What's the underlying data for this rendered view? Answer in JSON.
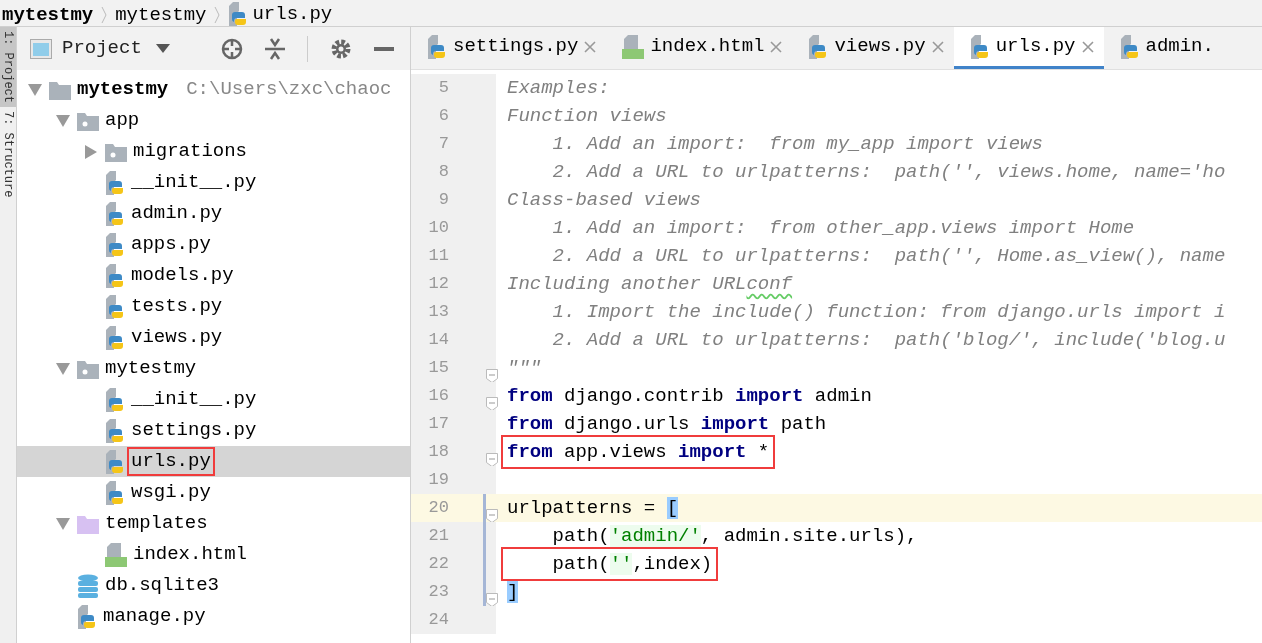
{
  "breadcrumb": [
    {
      "text": "mytestmy",
      "bold": true,
      "kind": "text"
    },
    {
      "text": "mytestmy",
      "bold": false,
      "kind": "text"
    },
    {
      "text": "urls.py",
      "bold": false,
      "kind": "py"
    }
  ],
  "tool_strip": [
    {
      "label": "1: Project",
      "selected": true
    },
    {
      "label": "7: Structure",
      "selected": false
    }
  ],
  "project_panel": {
    "title": "Project",
    "tree": [
      {
        "name": "mytestmy",
        "kind": "folder",
        "path": "C:\\Users\\zxc\\chaoc",
        "expanded": true,
        "selected": false,
        "annotated": false,
        "children": [
          {
            "name": "app",
            "kind": "package",
            "expanded": true,
            "selected": false,
            "annotated": false,
            "children": [
              {
                "name": "migrations",
                "kind": "package",
                "expanded": false,
                "selected": false,
                "annotated": false
              },
              {
                "name": "__init__.py",
                "kind": "py",
                "selected": false,
                "annotated": false
              },
              {
                "name": "admin.py",
                "kind": "py",
                "selected": false,
                "annotated": false
              },
              {
                "name": "apps.py",
                "kind": "py",
                "selected": false,
                "annotated": false
              },
              {
                "name": "models.py",
                "kind": "py",
                "selected": false,
                "annotated": false
              },
              {
                "name": "tests.py",
                "kind": "py",
                "selected": false,
                "annotated": false
              },
              {
                "name": "views.py",
                "kind": "py",
                "selected": false,
                "annotated": false
              }
            ]
          },
          {
            "name": "mytestmy",
            "kind": "package",
            "expanded": true,
            "selected": false,
            "annotated": false,
            "children": [
              {
                "name": "__init__.py",
                "kind": "py",
                "selected": false,
                "annotated": false
              },
              {
                "name": "settings.py",
                "kind": "py",
                "selected": false,
                "annotated": false
              },
              {
                "name": "urls.py",
                "kind": "py",
                "selected": true,
                "annotated": true
              },
              {
                "name": "wsgi.py",
                "kind": "py",
                "selected": false,
                "annotated": false
              }
            ]
          },
          {
            "name": "templates",
            "kind": "templates",
            "expanded": true,
            "selected": false,
            "annotated": false,
            "children": [
              {
                "name": "index.html",
                "kind": "html",
                "selected": false,
                "annotated": false
              }
            ]
          },
          {
            "name": "db.sqlite3",
            "kind": "db",
            "selected": false,
            "annotated": false
          },
          {
            "name": "manage.py",
            "kind": "py",
            "selected": false,
            "annotated": false
          }
        ]
      }
    ]
  },
  "tabs": [
    {
      "label": "settings.py",
      "kind": "py",
      "selected": false,
      "closable": true
    },
    {
      "label": "index.html",
      "kind": "html",
      "selected": false,
      "closable": true
    },
    {
      "label": "views.py",
      "kind": "py",
      "selected": false,
      "closable": true
    },
    {
      "label": "urls.py",
      "kind": "py",
      "selected": true,
      "closable": true
    },
    {
      "label": "admin.",
      "kind": "py",
      "selected": false,
      "closable": false
    }
  ],
  "editor": {
    "lines": [
      {
        "number": "5",
        "current": false,
        "modified": false,
        "fold": false,
        "annotated": false,
        "tokens": [
          {
            "kind": "comment",
            "text": "Examples:"
          }
        ]
      },
      {
        "number": "6",
        "current": false,
        "modified": false,
        "fold": false,
        "annotated": false,
        "tokens": [
          {
            "kind": "comment",
            "text": "Function views"
          }
        ]
      },
      {
        "number": "7",
        "current": false,
        "modified": false,
        "fold": false,
        "annotated": false,
        "tokens": [
          {
            "kind": "comment",
            "text": "    1. Add an import:  from my_app import views"
          }
        ]
      },
      {
        "number": "8",
        "current": false,
        "modified": false,
        "fold": false,
        "annotated": false,
        "tokens": [
          {
            "kind": "comment",
            "text": "    2. Add a URL to urlpatterns:  path('', views.home, name='ho"
          }
        ]
      },
      {
        "number": "9",
        "current": false,
        "modified": false,
        "fold": false,
        "annotated": false,
        "tokens": [
          {
            "kind": "comment",
            "text": "Class-based views"
          }
        ]
      },
      {
        "number": "10",
        "current": false,
        "modified": false,
        "fold": false,
        "annotated": false,
        "tokens": [
          {
            "kind": "comment",
            "text": "    1. Add an import:  from other_app.views import Home"
          }
        ]
      },
      {
        "number": "11",
        "current": false,
        "modified": false,
        "fold": false,
        "annotated": false,
        "tokens": [
          {
            "kind": "comment",
            "text": "    2. Add a URL to urlpatterns:  path('', Home.as_view(), name"
          }
        ]
      },
      {
        "number": "12",
        "current": false,
        "modified": false,
        "fold": false,
        "annotated": false,
        "tokens": [
          {
            "kind": "comment",
            "text": "Including another URL"
          },
          {
            "kind": "typo",
            "text": "conf"
          }
        ]
      },
      {
        "number": "13",
        "current": false,
        "modified": false,
        "fold": false,
        "annotated": false,
        "tokens": [
          {
            "kind": "comment",
            "text": "    1. Import the include() function: from django.urls import i"
          }
        ]
      },
      {
        "number": "14",
        "current": false,
        "modified": false,
        "fold": false,
        "annotated": false,
        "tokens": [
          {
            "kind": "comment",
            "text": "    2. Add a URL to urlpatterns:  path('blog/', include('blog.u"
          }
        ]
      },
      {
        "number": "15",
        "current": false,
        "modified": false,
        "fold": true,
        "annotated": false,
        "tokens": [
          {
            "kind": "comment",
            "text": "\"\"\""
          }
        ]
      },
      {
        "number": "16",
        "current": false,
        "modified": false,
        "fold": true,
        "annotated": false,
        "tokens": [
          {
            "kind": "keyword",
            "text": "from"
          },
          {
            "kind": "plain",
            "text": " django.contrib "
          },
          {
            "kind": "keyword",
            "text": "import"
          },
          {
            "kind": "plain",
            "text": " admin"
          }
        ]
      },
      {
        "number": "17",
        "current": false,
        "modified": false,
        "fold": false,
        "annotated": false,
        "tokens": [
          {
            "kind": "keyword",
            "text": "from"
          },
          {
            "kind": "plain",
            "text": " django.urls "
          },
          {
            "kind": "keyword",
            "text": "import"
          },
          {
            "kind": "plain",
            "text": " path"
          }
        ]
      },
      {
        "number": "18",
        "current": false,
        "modified": false,
        "fold": true,
        "annotated": true,
        "tokens": [
          {
            "kind": "keyword",
            "text": "from"
          },
          {
            "kind": "plain",
            "text": " app.views "
          },
          {
            "kind": "keyword",
            "text": "import"
          },
          {
            "kind": "plain",
            "text": " *"
          }
        ]
      },
      {
        "number": "19",
        "current": false,
        "modified": false,
        "fold": false,
        "annotated": false
      },
      {
        "number": "20",
        "current": true,
        "modified": true,
        "fold": true,
        "annotated": false,
        "tokens": [
          {
            "kind": "plain",
            "text": "urlpatterns = "
          },
          {
            "kind": "match",
            "text": "["
          }
        ]
      },
      {
        "number": "21",
        "current": false,
        "modified": true,
        "fold": false,
        "annotated": false,
        "tokens": [
          {
            "kind": "plain",
            "text": "    path("
          },
          {
            "kind": "string",
            "text": "'admin/'"
          },
          {
            "kind": "plain",
            "text": ", admin.site.urls),"
          }
        ]
      },
      {
        "number": "22",
        "current": false,
        "modified": true,
        "fold": false,
        "annotated": true,
        "tokens": [
          {
            "kind": "plain",
            "text": "    path("
          },
          {
            "kind": "string",
            "text": "''"
          },
          {
            "kind": "plain",
            "text": ",index)"
          }
        ]
      },
      {
        "number": "23",
        "current": false,
        "modified": true,
        "fold": true,
        "annotated": false,
        "tokens": [
          {
            "kind": "match",
            "text": "]"
          }
        ]
      },
      {
        "number": "24",
        "current": false,
        "modified": false,
        "fold": false,
        "annotated": false
      }
    ]
  }
}
